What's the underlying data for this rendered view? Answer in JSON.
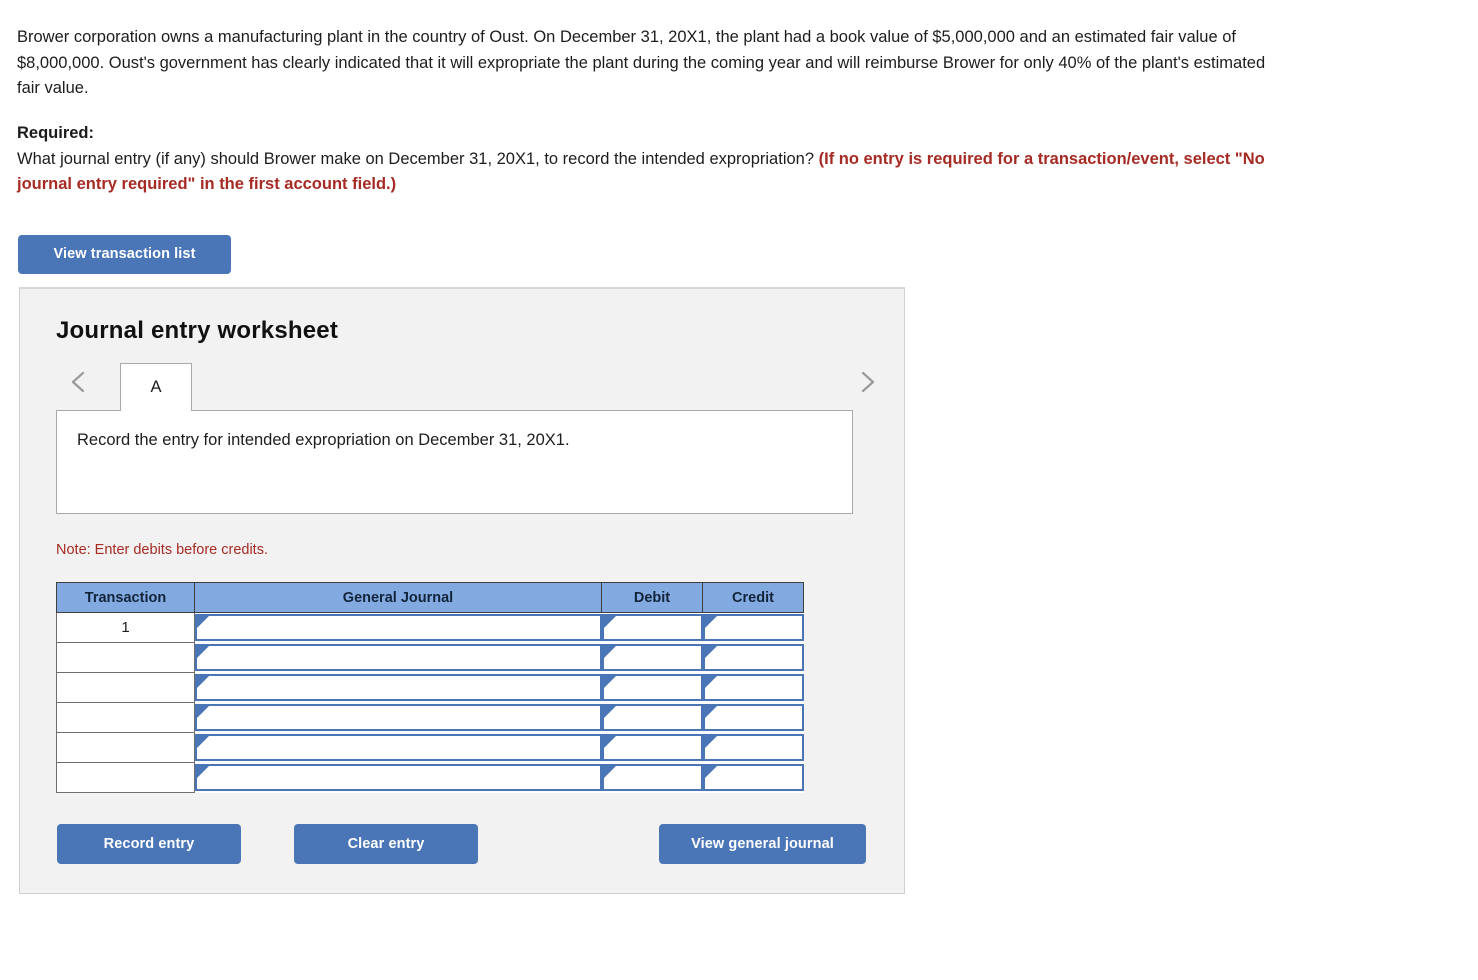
{
  "problem": {
    "text": "Brower corporation owns a manufacturing plant in the country of Oust. On December 31, 20X1, the plant had a book value of $5,000,000 and an estimated fair value of $8,000,000. Oust's government has clearly indicated that it will expropriate the plant during the coming year and will reimburse Brower for only 40% of the plant's estimated fair value."
  },
  "required": {
    "label": "Required:",
    "question": "What journal entry (if any) should Brower make on December 31, 20X1, to record the intended expropriation? ",
    "emphasis": "(If no entry is required for a transaction/event, select \"No journal entry required\" in the first account field.)"
  },
  "toolbar": {
    "view_transaction_list_label": "View transaction list"
  },
  "worksheet": {
    "title": "Journal entry worksheet",
    "tabs": [
      {
        "label": "A",
        "active": true
      }
    ],
    "nav": {
      "prev_icon": "chevron-left-icon",
      "next_icon": "chevron-right-icon"
    },
    "description": "Record the entry for intended expropriation on December 31, 20X1.",
    "note": "Note: Enter debits before credits.",
    "table": {
      "columns": [
        "Transaction",
        "General Journal",
        "Debit",
        "Credit"
      ],
      "rows": [
        {
          "transaction": "1",
          "general_journal": "",
          "debit": "",
          "credit": ""
        },
        {
          "transaction": "",
          "general_journal": "",
          "debit": "",
          "credit": ""
        },
        {
          "transaction": "",
          "general_journal": "",
          "debit": "",
          "credit": ""
        },
        {
          "transaction": "",
          "general_journal": "",
          "debit": "",
          "credit": ""
        },
        {
          "transaction": "",
          "general_journal": "",
          "debit": "",
          "credit": ""
        },
        {
          "transaction": "",
          "general_journal": "",
          "debit": "",
          "credit": ""
        }
      ]
    },
    "actions": {
      "record_entry_label": "Record entry",
      "clear_entry_label": "Clear entry",
      "view_general_journal_label": "View general journal"
    }
  },
  "colors": {
    "button_blue": "#4a76b8",
    "table_header_blue": "#82aae0",
    "note_red": "#a62b24",
    "panel_bg": "#f2f2f2"
  }
}
